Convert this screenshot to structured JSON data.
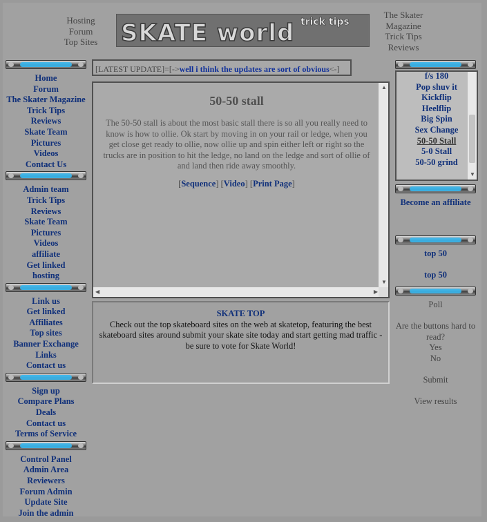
{
  "top_left_nav": [
    "Hosting",
    "Forum",
    "Top Sites"
  ],
  "top_right_nav": [
    "The Skater",
    "Magazine",
    "Trick Tips",
    "Reviews"
  ],
  "logo": {
    "main": "SKATE world",
    "tag": "trick tips"
  },
  "left": {
    "sections": [
      {
        "items": [
          "Home",
          "Forum",
          "The Skater Magazine",
          "Trick Tips",
          "Reviews",
          "Skate Team",
          "Pictures",
          "Videos",
          "Contact Us"
        ]
      },
      {
        "items": [
          "Admin team",
          "Trick Tips",
          "Reviews",
          "Skate Team",
          "Pictures",
          "Videos",
          "affiliate",
          "Get linked",
          "hosting"
        ]
      },
      {
        "items": [
          "Link us",
          "Get linked",
          "Affiliates",
          "Top sites",
          "Banner Exchange",
          "Links",
          "Contact us"
        ]
      },
      {
        "items": [
          "Sign up",
          "Compare Plans",
          "Deals",
          "Contact us",
          "Terms of Service"
        ]
      },
      {
        "items": [
          "Control Panel",
          "Admin Area",
          "Reviewers",
          "Forum Admin",
          "Update Site",
          "Join the admin"
        ]
      }
    ]
  },
  "update": {
    "prefix": "[LATEST UPDATE]=[->",
    "message": "well i think the updates are sort of obvious",
    "suffix": "<-]"
  },
  "article": {
    "title": "50-50 stall",
    "body": "The 50-50 stall is about the most basic stall there is so all you really need to know is how to ollie. Ok start by moving in on your rail or ledge, when you get close get ready to ollie, now ollie up and spin either left or right so the trucks are in position to hit the ledge, no land on the ledge and sort of ollie of and land then ride away smoothly.",
    "link_sequence": "Sequence",
    "link_video": "Video",
    "link_print": "Print Page",
    "bracket_open": "[",
    "bracket_close": "]"
  },
  "skatetop": {
    "title": "SKATE TOP",
    "text": "Check out the top skateboard sites on the web at skatetop, featuring the best skateboard sites around submit your skate site today and start getting mad traffic - be sure to vote for Skate World!"
  },
  "right": {
    "tricks": [
      "f/s 180",
      "Pop shuv it",
      "Kickflip",
      "Heelflip",
      "Big Spin",
      "Sex Change",
      "50-50 Stall",
      "5-0 Stall",
      "50-50 grind"
    ],
    "current_trick": "50-50 Stall",
    "affiliate_link": "Become an affiliate",
    "top50_a": "top 50",
    "top50_b": "top 50",
    "poll": {
      "title": "Poll",
      "question": "Are the buttons hard to read?",
      "opt_yes": "Yes",
      "opt_no": "No",
      "submit": "Submit",
      "results": "View results"
    }
  },
  "colors": {
    "link": "#10307a",
    "header_stripe": "#38b8f0",
    "background": "#a1a1a1"
  }
}
